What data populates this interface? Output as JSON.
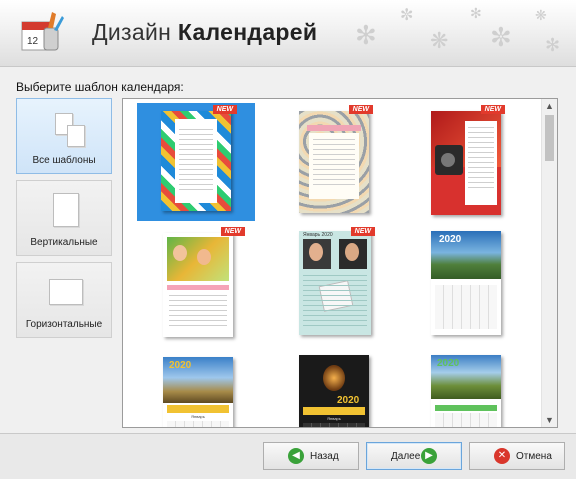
{
  "header": {
    "title_regular": "Дизайн",
    "title_bold": "Календарей",
    "calendar_icon_day": "12"
  },
  "prompt": "Выберите шаблон календаря:",
  "categories": [
    {
      "label": "Все шаблоны",
      "icon": "documents-icon",
      "selected": true
    },
    {
      "label": "Вертикальные",
      "icon": "portrait-page-icon",
      "selected": false
    },
    {
      "label": "Горизонтальные",
      "icon": "landscape-page-icon",
      "selected": false
    }
  ],
  "templates": [
    {
      "style": "colorful-patterns",
      "new_badge": "NEW",
      "selected": true
    },
    {
      "style": "floral-grey",
      "new_badge": "NEW",
      "selected": false
    },
    {
      "style": "red-photo",
      "new_badge": "NEW",
      "selected": false
    },
    {
      "style": "kids-photos",
      "new_badge": "NEW",
      "selected": false
    },
    {
      "style": "couple-photos",
      "new_badge": "NEW",
      "selected": false,
      "top_text": "Январь 2020"
    },
    {
      "style": "mountains-blue",
      "year": "2020",
      "selected": false
    },
    {
      "style": "mountains-gold",
      "year": "2020",
      "month": "Январь",
      "selected": false
    },
    {
      "style": "night-dark",
      "year": "2020",
      "month": "Январь",
      "selected": false
    },
    {
      "style": "mountains-green",
      "year": "2020",
      "selected": false
    }
  ],
  "buttons": {
    "back": "Назад",
    "next": "Далее",
    "cancel": "Отмена"
  },
  "colors": {
    "accent": "#2f8fe0",
    "new_badge": "#e23a2c",
    "back_icon": "#3aa23a",
    "next_icon": "#3aa23a",
    "cancel_icon": "#d9362b"
  }
}
